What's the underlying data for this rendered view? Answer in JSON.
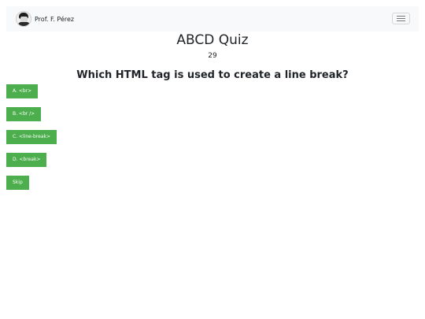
{
  "navbar": {
    "brand_name": "Prof. F. Pérez",
    "avatar_icon": "professor-avatar-icon",
    "menu_icon": "hamburger-menu-icon"
  },
  "quiz": {
    "title": "ABCD Quiz",
    "counter": "29",
    "question": "Which HTML tag is used to create a line break?",
    "answers": [
      "A. <br>",
      "B. <br />",
      "C. <line-break>",
      "D. <break>"
    ],
    "skip_label": "Skip",
    "button_color": "#4cae4c"
  }
}
